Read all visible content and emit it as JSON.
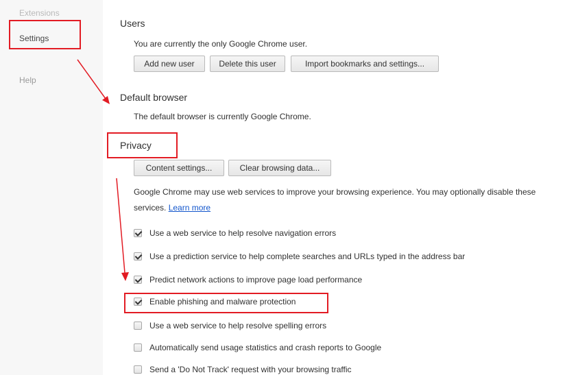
{
  "sidebar": {
    "items": [
      {
        "label": "Extensions"
      },
      {
        "label": "Settings"
      },
      {
        "label": "Help"
      }
    ]
  },
  "users": {
    "title": "Users",
    "description": "You are currently the only Google Chrome user.",
    "buttons": {
      "add": "Add new user",
      "delete": "Delete this user",
      "import": "Import bookmarks and settings..."
    }
  },
  "default_browser": {
    "title": "Default browser",
    "description": "The default browser is currently Google Chrome."
  },
  "privacy": {
    "title": "Privacy",
    "buttons": {
      "content_settings": "Content settings...",
      "clear_data": "Clear browsing data..."
    },
    "description_line1": "Google Chrome may use web services to improve your browsing experience. You may optionally disable these",
    "description_line2": "services.",
    "learn_more": "Learn more",
    "options": [
      {
        "label": "Use a web service to help resolve navigation errors",
        "checked": true
      },
      {
        "label": "Use a prediction service to help complete searches and URLs typed in the address bar",
        "checked": true
      },
      {
        "label": "Predict network actions to improve page load performance",
        "checked": true
      },
      {
        "label": "Enable phishing and malware protection",
        "checked": true
      },
      {
        "label": "Use a web service to help resolve spelling errors",
        "checked": false
      },
      {
        "label": "Automatically send usage statistics and crash reports to Google",
        "checked": false
      },
      {
        "label": "Send a 'Do Not Track' request with your browsing traffic",
        "checked": false
      }
    ]
  },
  "colors": {
    "annotation_red": "#e21b23",
    "link_blue": "#1155cc"
  }
}
